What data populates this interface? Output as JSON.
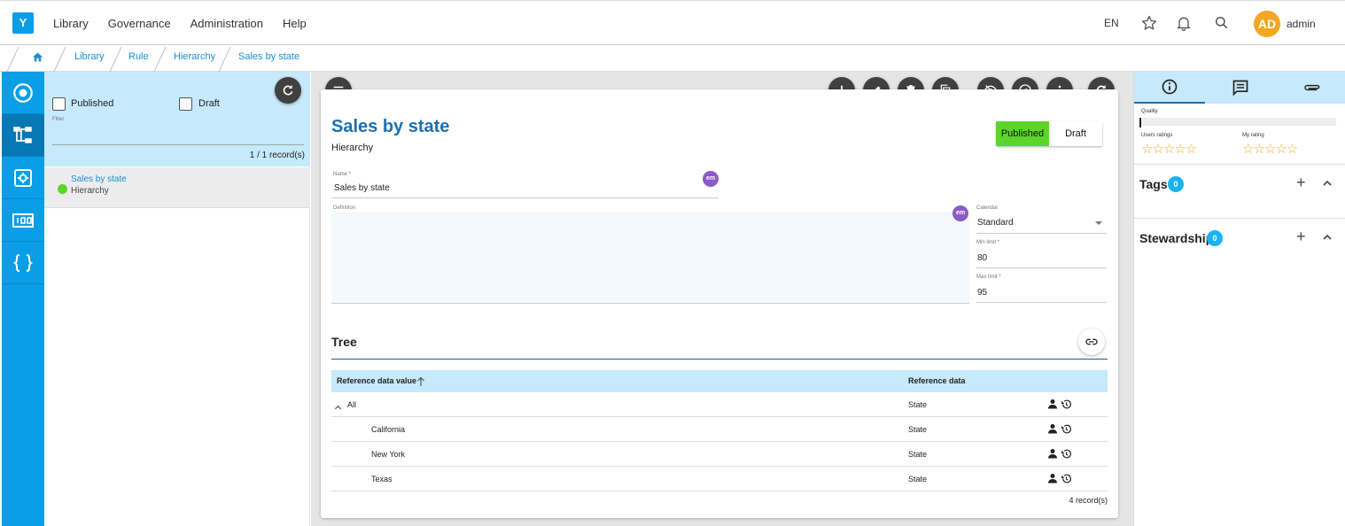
{
  "app": {
    "logo": "Y"
  },
  "topnav": [
    "Library",
    "Governance",
    "Administration",
    "Help"
  ],
  "topbar": {
    "lang": "EN",
    "avatar_initials": "AD",
    "username": "admin",
    "avatar_color": "#f5a623"
  },
  "breadcrumb": [
    "Library",
    "Rule",
    "Hierarchy",
    "Sales by state"
  ],
  "filter": {
    "published_label": "Published",
    "draft_label": "Draft",
    "filter_label": "Filter",
    "records": "1 / 1 record(s)"
  },
  "list": {
    "items": [
      {
        "title": "Sales by state",
        "subtitle": "Hierarchy",
        "status_color": "#5bd52b"
      }
    ]
  },
  "detail": {
    "title": "Sales by state",
    "subtitle": "Hierarchy",
    "status": {
      "published": "Published",
      "draft": "Draft",
      "active_color": "#5bd52b"
    },
    "name": {
      "label": "Name *",
      "value": "Sales by state",
      "badge": "em"
    },
    "definition": {
      "label": "Definition",
      "value": "",
      "badge": "em"
    },
    "calendar": {
      "label": "Calendar",
      "value": "Standard"
    },
    "min_limit": {
      "label": "Min limit *",
      "value": "80"
    },
    "max_limit": {
      "label": "Max limit *",
      "value": "95"
    }
  },
  "tree": {
    "title": "Tree",
    "columns": [
      "Reference data value",
      "Reference data"
    ],
    "rows": [
      {
        "value": "All",
        "reference": "State",
        "expanded": true
      },
      {
        "value": "California",
        "reference": "State"
      },
      {
        "value": "New York",
        "reference": "State"
      },
      {
        "value": "Texas",
        "reference": "State"
      }
    ],
    "records": "4 record(s)"
  },
  "right": {
    "quality_label": "Quality",
    "users_ratings_label": "Users ratings",
    "my_rating_label": "My rating",
    "users_rating_stars": "☆☆☆☆☆",
    "my_rating_stars": "☆☆☆☆☆",
    "tags": {
      "label": "Tags",
      "count": "0"
    },
    "stewardship": {
      "label": "Stewardship",
      "count": "0"
    }
  },
  "colors": {
    "brand": "#0a9ee6",
    "panel_light": "#c6e9fb",
    "title_blue": "#1a70b0",
    "badge_purple": "#8b5cc8"
  }
}
